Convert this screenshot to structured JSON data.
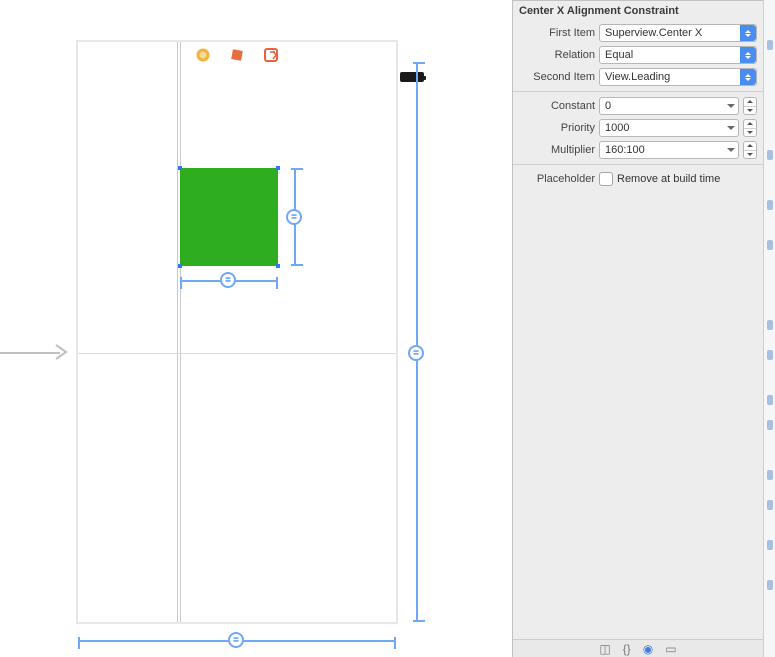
{
  "inspector": {
    "title": "Center X Alignment Constraint",
    "firstItem": {
      "label": "First Item",
      "value": "Superview.Center X"
    },
    "relation": {
      "label": "Relation",
      "value": "Equal"
    },
    "secondItem": {
      "label": "Second Item",
      "value": "View.Leading"
    },
    "constant": {
      "label": "Constant",
      "value": "0"
    },
    "priority": {
      "label": "Priority",
      "value": "1000"
    },
    "multiplier": {
      "label": "Multiplier",
      "value": "160:100"
    },
    "placeholder": {
      "label": "Placeholder",
      "checkboxLabel": "Remove at build time",
      "checked": false
    }
  },
  "canvas": {
    "pin_glyph": "="
  }
}
